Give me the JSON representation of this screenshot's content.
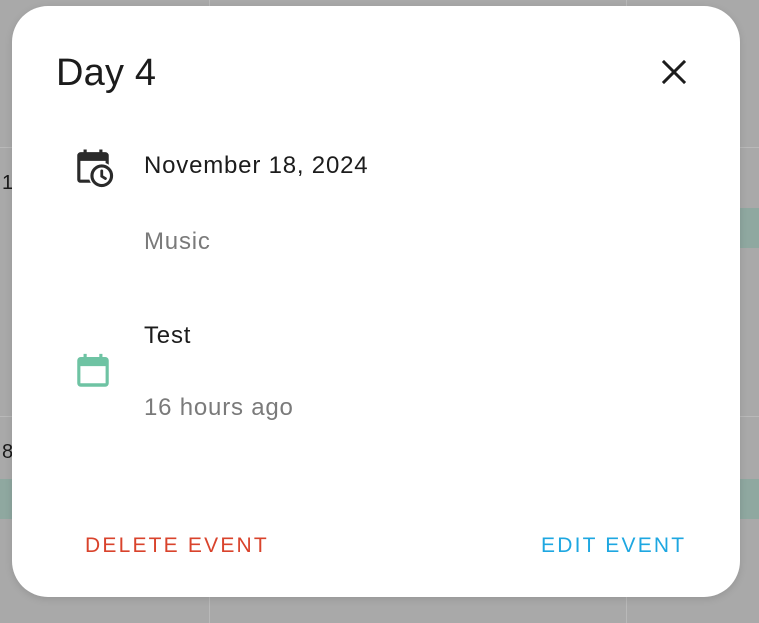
{
  "background": {
    "day_numbers": [
      "1",
      "8"
    ]
  },
  "dialog": {
    "title": "Day 4",
    "date_row": {
      "icon": "calendar-clock-icon",
      "date": "November 18, 2024",
      "calendar_name": "Music"
    },
    "event_row": {
      "icon": "calendar-icon",
      "icon_color": "#6ec3a3",
      "name": "Test",
      "relative_time": "16 hours ago"
    },
    "actions": {
      "delete_label": "DELETE EVENT",
      "delete_color": "#d9432c",
      "edit_label": "EDIT EVENT",
      "edit_color": "#1ea7e1"
    }
  }
}
